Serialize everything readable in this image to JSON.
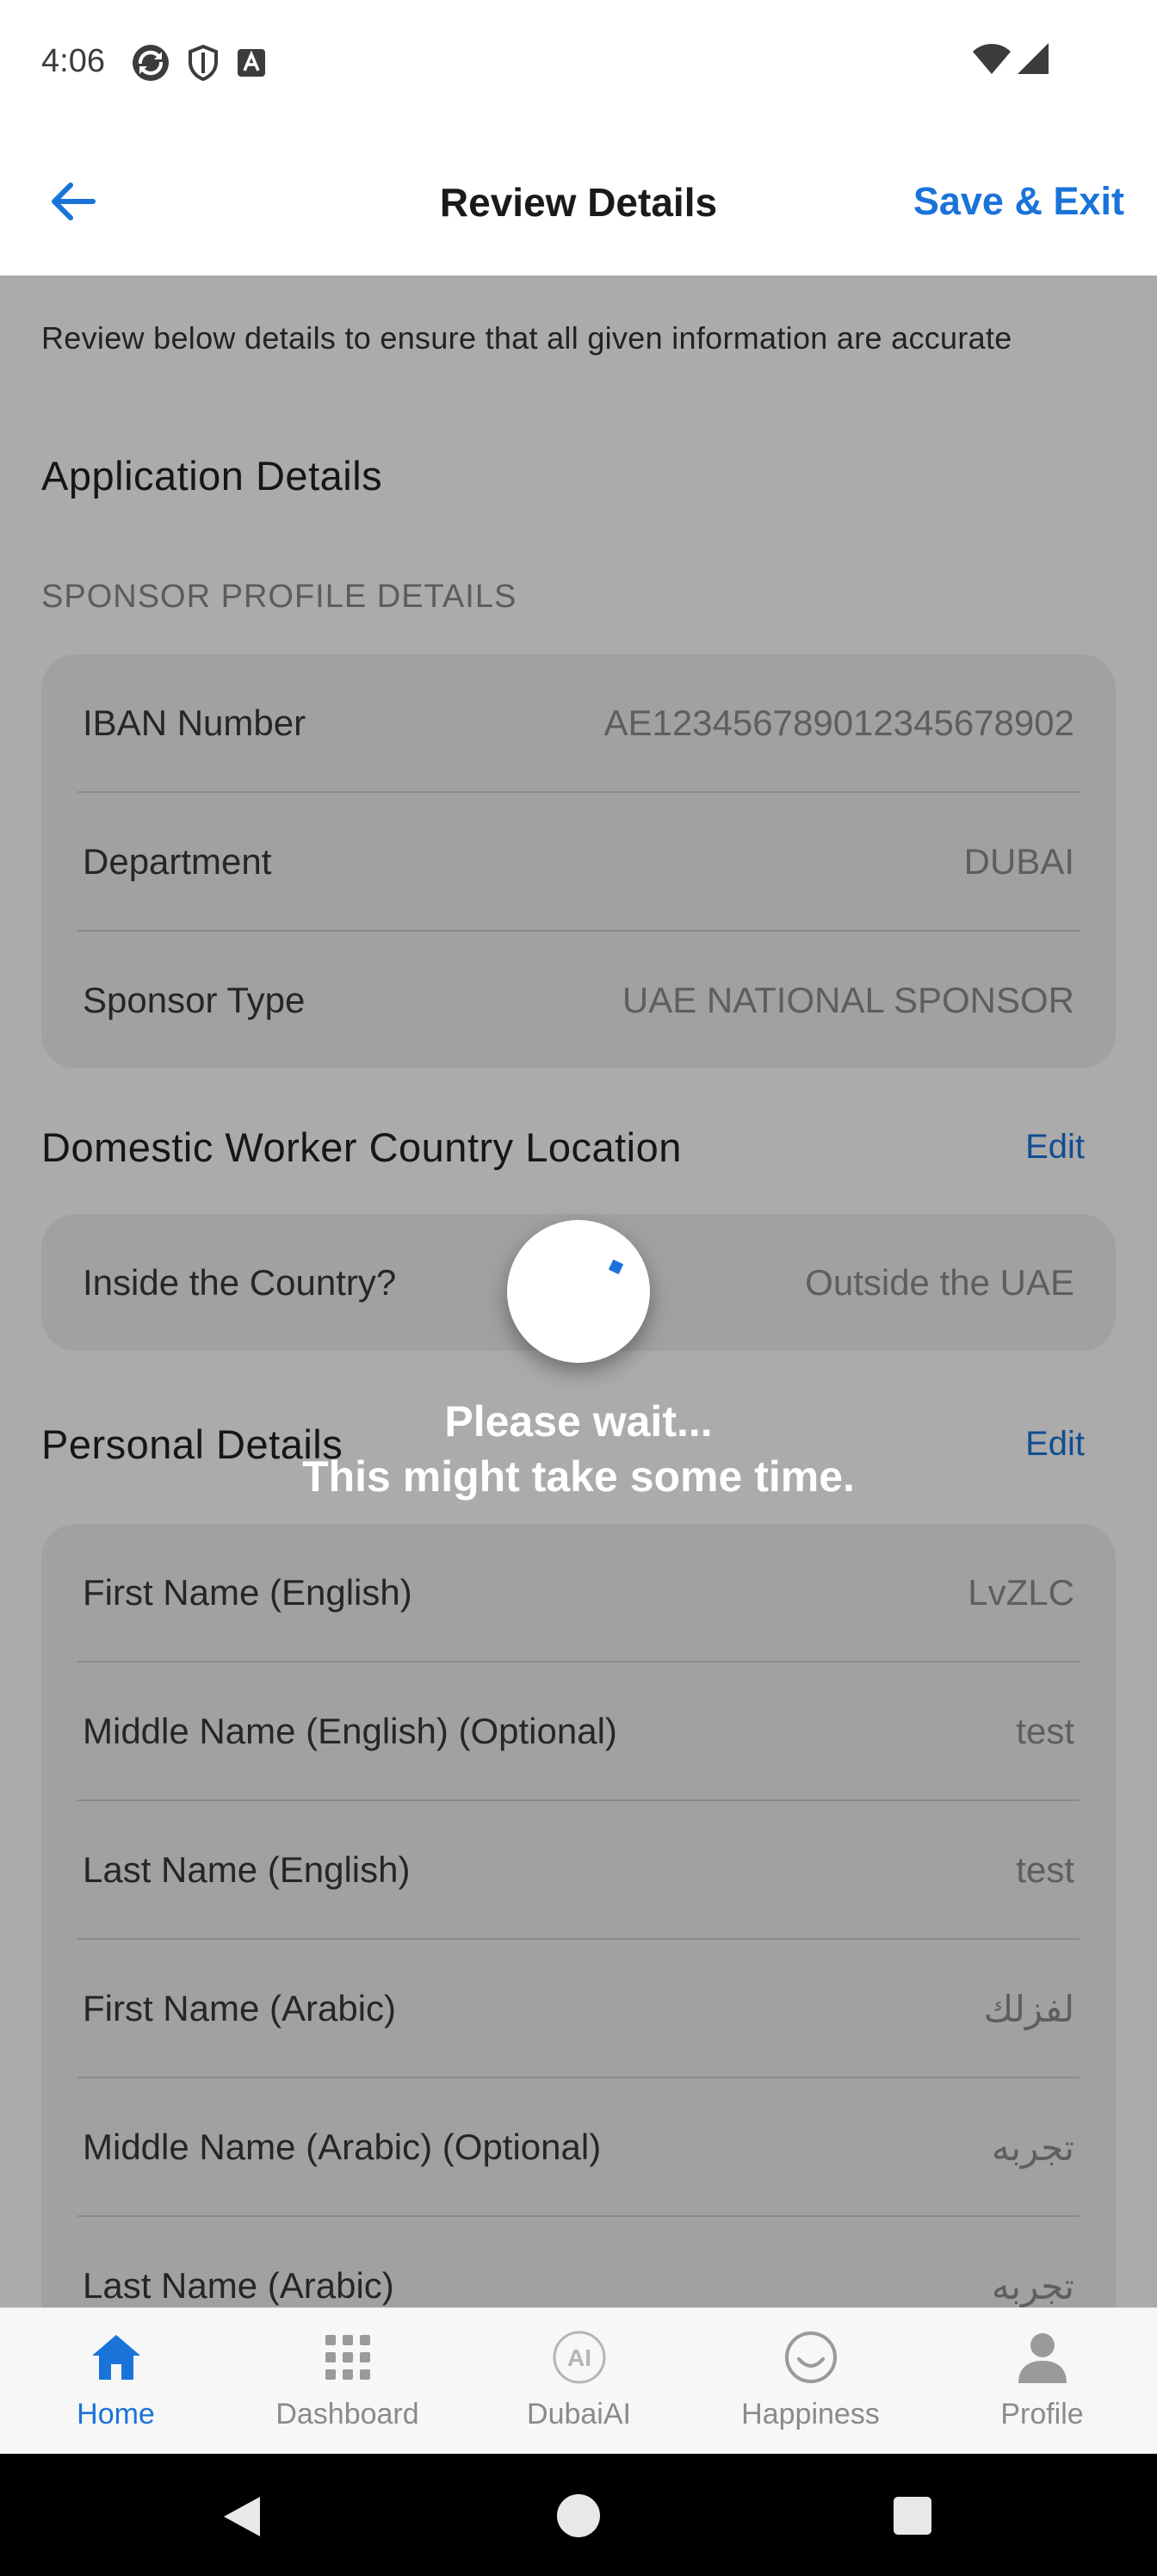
{
  "status_bar": {
    "time": "4:06"
  },
  "header": {
    "title": "Review Details",
    "save_exit_label": "Save & Exit"
  },
  "intro_text": "Review below details to ensure that all given information are accurate",
  "application_details": {
    "title": "Application Details",
    "sponsor_profile": {
      "subtitle": "SPONSOR PROFILE DETAILS",
      "rows": [
        {
          "label": "IBAN Number",
          "value": "AE12345678901234567890​2"
        },
        {
          "label": "Department",
          "value": "DUBAI"
        },
        {
          "label": "Sponsor Type",
          "value": "UAE NATIONAL SPONSOR"
        }
      ]
    }
  },
  "domestic_worker_location": {
    "title": "Domestic Worker Country Location",
    "edit_label": "Edit",
    "rows": [
      {
        "label": "Inside the Country?",
        "value": "Outside the UAE"
      }
    ]
  },
  "personal_details": {
    "title": "Personal Details",
    "edit_label": "Edit",
    "rows": [
      {
        "label": "First Name (English)",
        "value": "LvZLC"
      },
      {
        "label": "Middle Name (English) (Optional)",
        "value": "test"
      },
      {
        "label": "Last Name (English)",
        "value": "test"
      },
      {
        "label": "First Name (Arabic)",
        "value": "لفزلك"
      },
      {
        "label": "Middle Name (Arabic) (Optional)",
        "value": "تجربه"
      },
      {
        "label": "Last Name (Arabic)",
        "value": "تجربه"
      }
    ]
  },
  "loading": {
    "line1": "Please wait...",
    "line2": "This might take some time."
  },
  "bottom_nav": {
    "items": [
      {
        "label": "Home",
        "icon": "home-icon",
        "active": true
      },
      {
        "label": "Dashboard",
        "icon": "grid-icon",
        "active": false
      },
      {
        "label": "DubaiAI",
        "icon": "ai-icon",
        "active": false
      },
      {
        "label": "Happiness",
        "icon": "smile-icon",
        "active": false
      },
      {
        "label": "Profile",
        "icon": "person-icon",
        "active": false
      }
    ]
  },
  "colors": {
    "accent": "#1a73d9",
    "overlay": "rgba(0,0,0,0.33)"
  }
}
